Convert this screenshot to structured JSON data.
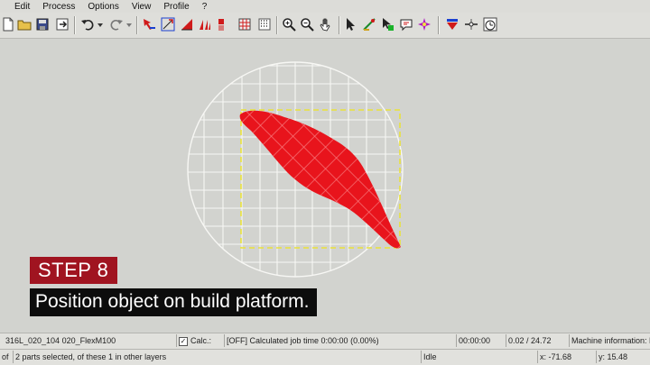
{
  "menu": {
    "items": [
      "Edit",
      "Process",
      "Options",
      "View",
      "Profile",
      "?"
    ]
  },
  "toolbar": {
    "buttons": [
      "new-file-icon",
      "open-folder-icon",
      "save-icon",
      "export-icon",
      "undo-icon",
      "undo-dropdown-icon",
      "redo-icon",
      "redo-dropdown-icon",
      "move-arrows-icon",
      "rotate-select-icon",
      "triangle-tool-icon",
      "slope-tool-icon",
      "support-tool-icon",
      "mesh-tool-icon",
      "grid-fill-icon",
      "zoom-in-icon",
      "zoom-out-icon",
      "pan-hand-icon",
      "select-arrow-icon",
      "measure-icon",
      "node-edit-icon",
      "comment-icon",
      "sparkle-icon",
      "layer-icon",
      "laser-icon",
      "timer-icon"
    ]
  },
  "colors": {
    "part": "#e8141c",
    "platform_grid": "#f7f7f4",
    "job_frame": "#e9e23a",
    "step_banner": "#a01420"
  },
  "overlay": {
    "step_label": "STEP 8",
    "caption": "Position object on build platform."
  },
  "status": {
    "job_file": "316L_020_104 020_FlexM100",
    "calc_label": "Calc.:",
    "calc_checked": true,
    "calc_text": "[OFF]  Calculated job time 0:00:00  (0.00%)",
    "elapsed": "00:00:00",
    "layers": "0.02 / 24.72",
    "machine_info": "Machine information: M",
    "selection_prefix": "of",
    "selection_text": "2 parts selected, of these   1 in other layers",
    "state": "Idle",
    "x_coord": "x: -71.68",
    "y_coord": "y: 15.48"
  }
}
